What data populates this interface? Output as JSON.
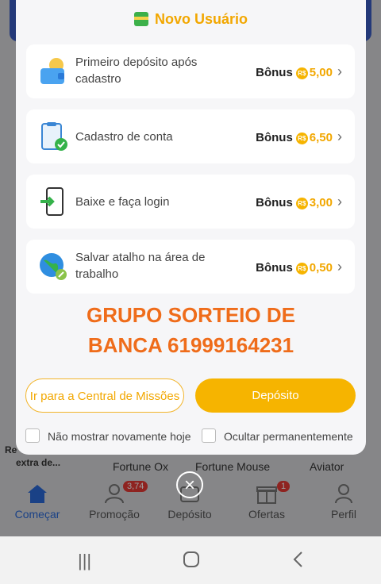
{
  "modal": {
    "title": "Novo Usuário",
    "items": [
      {
        "label": "Primeiro depósito após cadastro",
        "bonus_label": "Bônus",
        "amount": "5,00",
        "icon": "wallet-icon"
      },
      {
        "label": "Cadastro de conta",
        "bonus_label": "Bônus",
        "amount": "6,50",
        "icon": "clipboard-check-icon"
      },
      {
        "label": "Baixe e faça login",
        "bonus_label": "Bônus",
        "amount": "3,00",
        "icon": "phone-login-icon"
      },
      {
        "label": "Salvar atalho na área de trabalho",
        "bonus_label": "Bônus",
        "amount": "0,50",
        "icon": "globe-link-icon"
      }
    ],
    "currency": "R$",
    "promo_line1": "GRUPO SORTEIO DE",
    "promo_line2": "BANCA 61999164231",
    "missions_button": "Ir para a Central de Missões",
    "deposit_button": "Depósito",
    "dont_show_again": "Não mostrar novamente hoje",
    "hide_permanently": "Ocultar permanentemente"
  },
  "background": {
    "games": [
      "Fortune Ox",
      "Fortune Mouse",
      "Aviator"
    ],
    "side_left": [
      "Re",
      "extra de..."
    ],
    "nav": [
      {
        "label": "Começar",
        "active": true
      },
      {
        "label": "Promoção",
        "badge": "3,74"
      },
      {
        "label": "Depósito"
      },
      {
        "label": "Ofertas",
        "badge": "1"
      },
      {
        "label": "Perfil"
      }
    ]
  },
  "colors": {
    "accent": "#f6b400",
    "promo": "#ef6c1a",
    "nav_active": "#2a6ad8"
  }
}
